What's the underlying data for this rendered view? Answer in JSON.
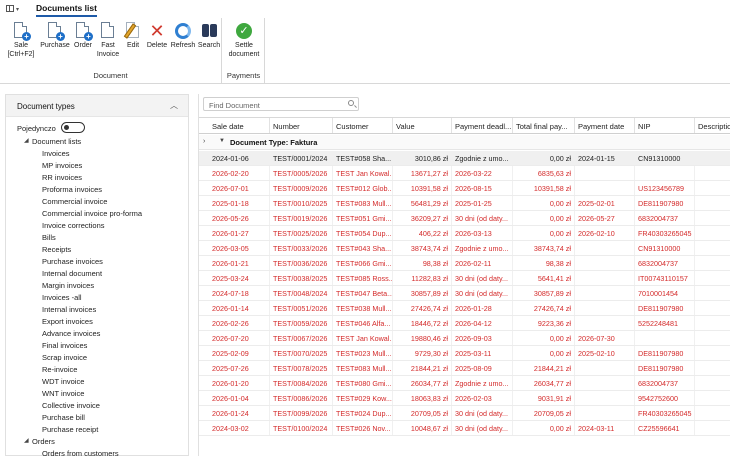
{
  "tab": {
    "title": "Documents list"
  },
  "ribbon": {
    "groups": [
      {
        "label": "Document"
      },
      {
        "label": "Payments"
      }
    ],
    "buttons": {
      "sale": "Sale [Ctrl+F2]",
      "sale_line1": "Sale",
      "sale_line2": "[Ctrl+F2]",
      "purchase": "Purchase",
      "order": "Order",
      "fast_invoice_line1": "Fast",
      "fast_invoice_line2": "Invoice",
      "edit": "Edit",
      "delete": "Delete",
      "refresh": "Refresh",
      "search": "Search",
      "settle_line1": "Settle",
      "settle_line2": "document"
    }
  },
  "left_panel": {
    "title": "Document types",
    "toggle_label": "Pojedynczo",
    "toggle_on": false,
    "tree_root": "Document lists",
    "items": [
      "Invoices",
      "MP invoices",
      "RR invoices",
      "Proforma invoices",
      "Commercial invoice",
      "Commercial invoice pro-forma",
      "Invoice corrections",
      "Bills",
      "Receipts",
      "Purchase invoices",
      "Internal document",
      "Margin invoices",
      "Invoices -all",
      "Internal invoices",
      "Export invoices",
      "Advance invoices",
      "Final invoices",
      "Scrap invoice",
      "Re-invoice",
      "WDT invoice",
      "WNT invoice",
      "Collective invoice",
      "Purchase bill",
      "Purchase receipt"
    ],
    "orders_root": "Orders",
    "orders_child": "Orders from customers"
  },
  "search": {
    "placeholder": "Find Document"
  },
  "grid": {
    "columns": [
      "Sale date",
      "Number",
      "Customer",
      "Value",
      "Payment deadl...",
      "Total final pay...",
      "Payment date",
      "NIP",
      "Descriptio"
    ],
    "group_title": "Document Type: Faktura",
    "rows": [
      {
        "color": "black",
        "cells": [
          "2024-01-06",
          "TEST/0001/2024",
          "TEST#058 Sha...",
          "3010,86 zł",
          "Zgodnie z umo...",
          "0,00 zł",
          "2024-01-15",
          "CN91310000",
          ""
        ]
      },
      {
        "color": "red",
        "cells": [
          "2026-02-20",
          "TEST/0005/2026",
          "TEST Jan Kowal...",
          "13671,27 zł",
          "2026-03-22",
          "6835,63 zł",
          "",
          "",
          ""
        ]
      },
      {
        "color": "red",
        "cells": [
          "2026-07-01",
          "TEST/0009/2026",
          "TEST#012 Glob...",
          "10391,58 zł",
          "2026-08-15",
          "10391,58 zł",
          "",
          "US123456789",
          ""
        ]
      },
      {
        "color": "red",
        "cells": [
          "2025-01-18",
          "TEST/0010/2025",
          "TEST#083 Mull...",
          "56481,29 zł",
          "2025-01-25",
          "0,00 zł",
          "2025-02-01",
          "DE811907980",
          ""
        ]
      },
      {
        "color": "red",
        "cells": [
          "2026-05-26",
          "TEST/0019/2026",
          "TEST#051 Gmi...",
          "36209,27 zł",
          "30 dni (od daty...",
          "0,00 zł",
          "2026-05-27",
          "6832004737",
          ""
        ]
      },
      {
        "color": "red",
        "cells": [
          "2026-01-27",
          "TEST/0025/2026",
          "TEST#054 Dup...",
          "406,22 zł",
          "2026-03-13",
          "0,00 zł",
          "2026-02-10",
          "FR40303265045",
          ""
        ]
      },
      {
        "color": "red",
        "cells": [
          "2026-03-05",
          "TEST/0033/2026",
          "TEST#043 Sha...",
          "38743,74 zł",
          "Zgodnie z umo...",
          "38743,74 zł",
          "",
          "CN91310000",
          ""
        ]
      },
      {
        "color": "red",
        "cells": [
          "2026-01-21",
          "TEST/0036/2026",
          "TEST#066 Gmi...",
          "98,38 zł",
          "2026-02-11",
          "98,38 zł",
          "",
          "6832004737",
          ""
        ]
      },
      {
        "color": "red",
        "cells": [
          "2025-03-24",
          "TEST/0038/2025",
          "TEST#085 Ross...",
          "11282,83 zł",
          "30 dni (od daty...",
          "5641,41 zł",
          "",
          "IT00743110157",
          ""
        ]
      },
      {
        "color": "red",
        "cells": [
          "2024-07-18",
          "TEST/0048/2024",
          "TEST#047 Beta...",
          "30857,89 zł",
          "30 dni (od daty...",
          "30857,89 zł",
          "",
          "7010001454",
          ""
        ]
      },
      {
        "color": "red",
        "cells": [
          "2026-01-14",
          "TEST/0051/2026",
          "TEST#038 Mull...",
          "27426,74 zł",
          "2026-01-28",
          "27426,74 zł",
          "",
          "DE811907980",
          ""
        ]
      },
      {
        "color": "red",
        "cells": [
          "2026-02-26",
          "TEST/0059/2026",
          "TEST#046 Alfa...",
          "18446,72 zł",
          "2026-04-12",
          "9223,36 zł",
          "",
          "5252248481",
          ""
        ]
      },
      {
        "color": "red",
        "cells": [
          "2026-07-20",
          "TEST/0067/2026",
          "TEST Jan Kowal...",
          "19880,46 zł",
          "2026-09-03",
          "0,00 zł",
          "2026-07-30",
          "",
          ""
        ]
      },
      {
        "color": "red",
        "cells": [
          "2025-02-09",
          "TEST/0070/2025",
          "TEST#023 Mull...",
          "9729,30 zł",
          "2025-03-11",
          "0,00 zł",
          "2025-02-10",
          "DE811907980",
          ""
        ]
      },
      {
        "color": "red",
        "cells": [
          "2025-07-26",
          "TEST/0078/2025",
          "TEST#083 Mull...",
          "21844,21 zł",
          "2025-08-09",
          "21844,21 zł",
          "",
          "DE811907980",
          ""
        ]
      },
      {
        "color": "red",
        "cells": [
          "2026-01-20",
          "TEST/0084/2026",
          "TEST#080 Gmi...",
          "26034,77 zł",
          "Zgodnie z umo...",
          "26034,77 zł",
          "",
          "6832004737",
          ""
        ]
      },
      {
        "color": "red",
        "cells": [
          "2026-01-04",
          "TEST/0086/2026",
          "TEST#029 Kow...",
          "18063,83 zł",
          "2026-02-03",
          "9031,91 zł",
          "",
          "9542752600",
          ""
        ]
      },
      {
        "color": "red",
        "cells": [
          "2026-01-24",
          "TEST/0099/2026",
          "TEST#024 Dup...",
          "20709,05 zł",
          "30 dni (od daty...",
          "20709,05 zł",
          "",
          "FR40303265045",
          ""
        ]
      },
      {
        "color": "red",
        "cells": [
          "2024-03-02",
          "TEST/0100/2024",
          "TEST#026 Nov...",
          "10048,67 zł",
          "30 dni (od daty...",
          "0,00 zł",
          "2024-03-11",
          "CZ25596641",
          ""
        ]
      }
    ]
  },
  "colors": {
    "accent": "#1e5aa8",
    "overdue_text": "#d42b2b",
    "normal_text": "#222222"
  }
}
